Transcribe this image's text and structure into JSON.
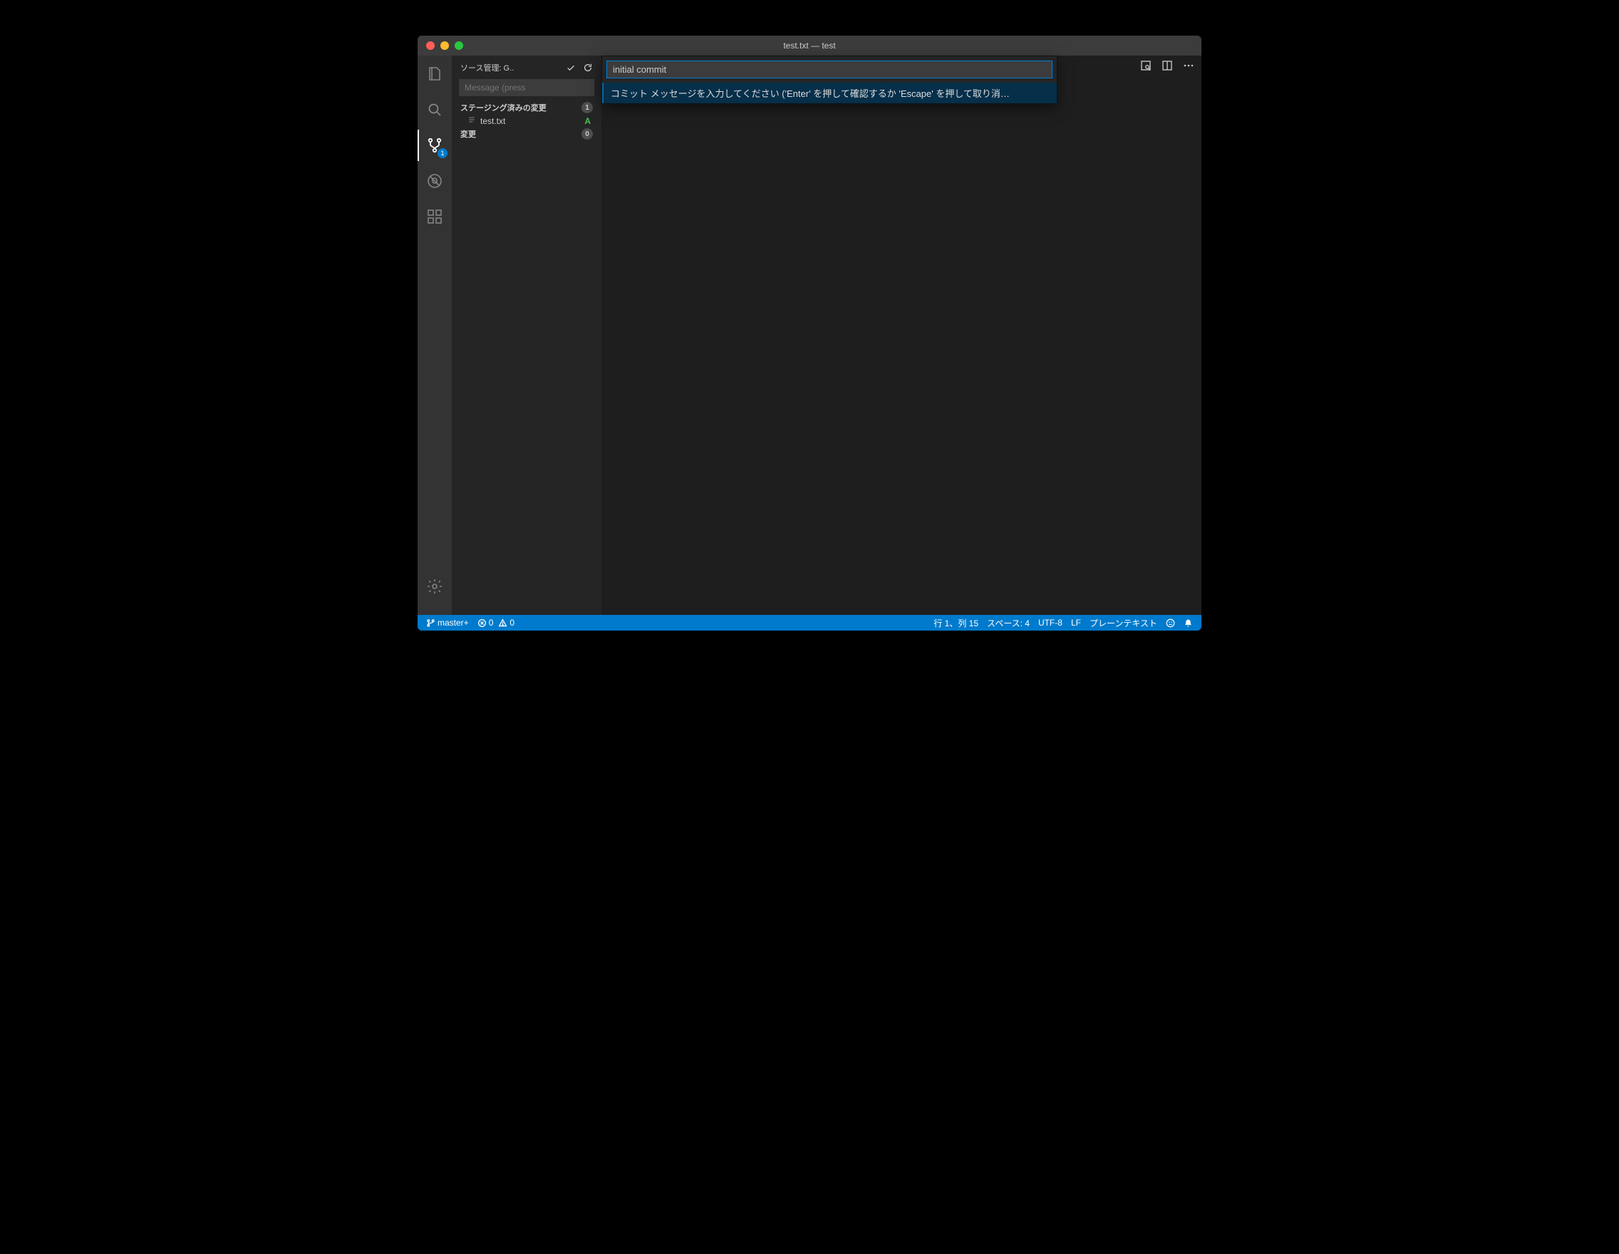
{
  "titlebar": {
    "title": "test.txt — test"
  },
  "activity": {
    "scm_badge": "1"
  },
  "sidebar": {
    "header_title": "ソース管理: G..",
    "commit_placeholder": "Message (press",
    "staged_label": "ステージング済みの変更",
    "staged_count": "1",
    "file_name": "test.txt",
    "file_status": "A",
    "changes_label": "変更",
    "changes_count": "0"
  },
  "palette": {
    "input_value": "initial commit",
    "hint": "コミット メッセージを入力してください ('Enter' を押して確認するか 'Escape' を押して取り消…"
  },
  "statusbar": {
    "branch": "master+",
    "errors": "0",
    "warnings": "0",
    "line_col": "行 1、列 15",
    "spaces": "スペース: 4",
    "encoding": "UTF-8",
    "eol": "LF",
    "lang": "プレーンテキスト"
  }
}
